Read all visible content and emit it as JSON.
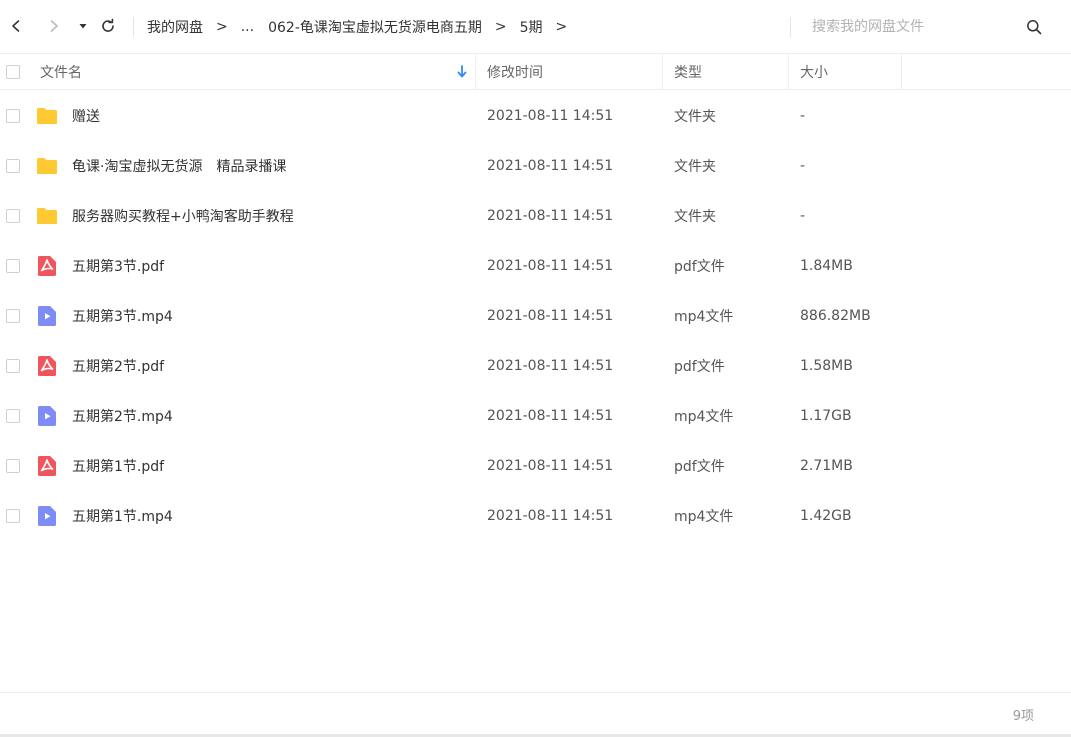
{
  "toolbar": {
    "back_icon": "chevron-left-icon",
    "forward_icon": "chevron-right-icon",
    "dropdown_icon": "caret-down-icon",
    "refresh_icon": "refresh-icon",
    "breadcrumb": [
      {
        "label": "我的网盘"
      },
      {
        "label": "..."
      },
      {
        "label": "062-龟课淘宝虚拟无货源电商五期"
      },
      {
        "label": "5期"
      }
    ],
    "search_placeholder": "搜索我的网盘文件",
    "search_icon": "search-icon"
  },
  "header": {
    "name": "文件名",
    "modified": "修改时间",
    "type": "类型",
    "size": "大小",
    "sort_icon": "sort-down-arrow-icon"
  },
  "colors": {
    "folder": "#FFC933",
    "pdf": "#F0555E",
    "video": "#7F8CF5",
    "sort_arrow": "#2F8BF5"
  },
  "files": [
    {
      "name": "赠送",
      "modified": "2021-08-11 14:51",
      "type": "文件夹",
      "size": "-",
      "icon": "folder"
    },
    {
      "name": "龟课·淘宝虚拟无货源　精品录播课",
      "modified": "2021-08-11 14:51",
      "type": "文件夹",
      "size": "-",
      "icon": "folder"
    },
    {
      "name": "服务器购买教程+小鸭淘客助手教程",
      "modified": "2021-08-11 14:51",
      "type": "文件夹",
      "size": "-",
      "icon": "folder"
    },
    {
      "name": "五期第3节.pdf",
      "modified": "2021-08-11 14:51",
      "type": "pdf文件",
      "size": "1.84MB",
      "icon": "pdf"
    },
    {
      "name": "五期第3节.mp4",
      "modified": "2021-08-11 14:51",
      "type": "mp4文件",
      "size": "886.82MB",
      "icon": "video"
    },
    {
      "name": "五期第2节.pdf",
      "modified": "2021-08-11 14:51",
      "type": "pdf文件",
      "size": "1.58MB",
      "icon": "pdf"
    },
    {
      "name": "五期第2节.mp4",
      "modified": "2021-08-11 14:51",
      "type": "mp4文件",
      "size": "1.17GB",
      "icon": "video"
    },
    {
      "name": "五期第1节.pdf",
      "modified": "2021-08-11 14:51",
      "type": "pdf文件",
      "size": "2.71MB",
      "icon": "pdf"
    },
    {
      "name": "五期第1节.mp4",
      "modified": "2021-08-11 14:51",
      "type": "mp4文件",
      "size": "1.42GB",
      "icon": "video"
    }
  ],
  "footer": {
    "count": "9项"
  }
}
